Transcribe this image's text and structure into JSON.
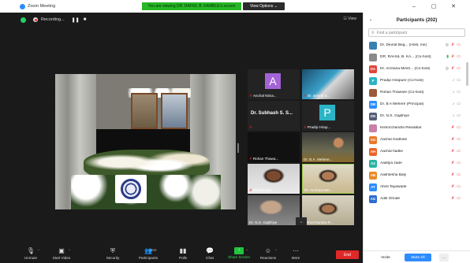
{
  "window": {
    "title": "Zoom Meeting",
    "viewing_banner": "You are viewing DR. RAHUL B. KAMBLE's screen",
    "view_options": "View Options",
    "minimize": "–",
    "maximize": "▢",
    "close": "✕"
  },
  "meeting_top": {
    "recording_label": "Recording...",
    "pause_glyph": "❚❚",
    "stop_glyph": "■",
    "view_label": "☷ View"
  },
  "tiles": [
    {
      "name": "Anchal Nitna...",
      "avatar": "A",
      "avatar_color": "#a463d6"
    },
    {
      "name": "Dr. Devrat B..."
    },
    {
      "name": "Dr. Subhash S. S..."
    },
    {
      "name": "Pradip Hirap...",
      "avatar": "P",
      "avatar_color": "#2bb4c6"
    },
    {
      "name": "Rohan Thawa..."
    },
    {
      "name": "Dr. B.A. Mehere..."
    },
    {
      "name": "sfpkldongle"
    },
    {
      "name": "Dr. Archana Me..."
    },
    {
      "name": "Dr. N.S. Gajbhiye"
    },
    {
      "name": "Kishorchandra R..."
    }
  ],
  "toolbar": {
    "unmute": "Unmute",
    "start_video": "Start Video",
    "security": "Security",
    "participants": "Participants",
    "participants_count": "202",
    "polls": "Polls",
    "chat": "Chat",
    "share_screen": "Share Screen",
    "reactions": "Reactions",
    "more": "More",
    "end": "End"
  },
  "panel": {
    "title": "Participants (202)",
    "search_placeholder": "Find a participant",
    "invite": "Invite",
    "mute_all": "Mute All",
    "more": "..."
  },
  "participants": [
    {
      "name": "Dr. Devrat Beg... (Host, me)",
      "initials": "",
      "color": "#3a7fb0",
      "status": "host"
    },
    {
      "name": "DR. RAHUL B. KA... (Co-host)",
      "initials": "",
      "color": "#8a8a8a",
      "status": "sharing"
    },
    {
      "name": "Dr. Archana Mesh... (Co-host)",
      "initials": "DA",
      "color": "#e0453a",
      "status": "host"
    },
    {
      "name": "Pradip Hirapure (Co-host)",
      "initials": "P",
      "color": "#2bb4c6",
      "status": "open"
    },
    {
      "name": "Rohan Thaware (Co-host)",
      "initials": "",
      "color": "#9a5a3a",
      "status": "open"
    },
    {
      "name": "Dr. B A Mehere (Principal)",
      "initials": "DB",
      "color": "#2d8cff",
      "status": "open"
    },
    {
      "name": "Dr. N.S. Gajbhiye",
      "initials": "DN",
      "color": "#555e75",
      "status": "open"
    },
    {
      "name": "Kishorchandra Rewatkar",
      "initials": "",
      "color": "#c97fa8",
      "status": "muted"
    },
    {
      "name": "Aachal Godbole",
      "initials": "AG",
      "color": "#e87a2a",
      "status": "muted"
    },
    {
      "name": "Aachal hadke",
      "initials": "AH",
      "color": "#e8642a",
      "status": "muted"
    },
    {
      "name": "Aaditya zade",
      "initials": "AZ",
      "color": "#2bb4a0",
      "status": "muted"
    },
    {
      "name": "Aashlesha Baly",
      "initials": "AB",
      "color": "#e88a2a",
      "status": "muted"
    },
    {
      "name": "Aboli Tayawade",
      "initials": "AT",
      "color": "#2d8cff",
      "status": "muted"
    },
    {
      "name": "Aditi Ghode",
      "initials": "AG",
      "color": "#2d6ccf",
      "status": "muted"
    }
  ]
}
